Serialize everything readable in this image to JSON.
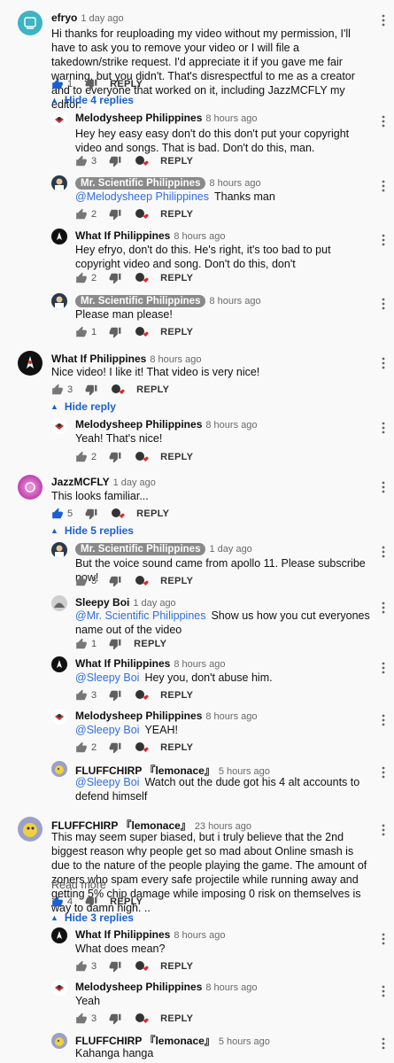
{
  "labels": {
    "reply": "REPLY",
    "read_more": "Read more"
  },
  "c1": {
    "author": "efryo",
    "time": "1 day ago",
    "text": "Hi thanks for reuploading my video without my permission, I'll have to ask you to remove your video or I will file a takedown/strike request. I'd appreciate it if you gave me fair warning, but you didn't. That's disrespectful to me as a creator and to everyone that worked on it, including JazzMCFLY my editor.",
    "likes": "1",
    "toggle": "Hide 4 replies",
    "r1": {
      "author": "Melodysheep Philippines",
      "time": "8 hours ago",
      "text": "Hey hey easy easy don't do this don't put your copyright video and songs. That is bad. Don't do this, man.",
      "likes": "3"
    },
    "r2": {
      "author": "Mr. Scientific Philippines",
      "time": "8 hours ago",
      "mention": "@Melodysheep Philippines",
      "text": "Thanks man",
      "likes": "2"
    },
    "r3": {
      "author": "What If Philippines",
      "time": "8 hours ago",
      "text": "Hey efryo, don't do this. He's right, it's too bad to put copyright video and song. Don't do this, don't",
      "likes": "2"
    },
    "r4": {
      "author": "Mr. Scientific Philippines",
      "time": "8 hours ago",
      "text": "Please man please!",
      "likes": "1"
    }
  },
  "c2": {
    "author": "What If Philippines",
    "time": "8 hours ago",
    "text": "Nice video! I like it! That video is very nice!",
    "likes": "3",
    "toggle": "Hide reply",
    "r1": {
      "author": "Melodysheep Philippines",
      "time": "8 hours ago",
      "text": "Yeah! That's nice!",
      "likes": "2"
    }
  },
  "c3": {
    "author": "JazzMCFLY",
    "time": "1 day ago",
    "text": "This looks familiar...",
    "likes": "5",
    "toggle": "Hide 5 replies",
    "r1": {
      "author": "Mr. Scientific Philippines",
      "time": "1 day ago",
      "text": "But the voice sound came from apollo 11. Please subscribe now!",
      "likes": "3"
    },
    "r2": {
      "author": "Sleepy Boi",
      "time": "1 day ago",
      "mention": "@Mr. Scientific Philippines",
      "text": "Show us how you cut everyones name out of the video",
      "likes": "1"
    },
    "r3": {
      "author": "What If Philippines",
      "time": "8 hours ago",
      "mention": "@Sleepy Boi",
      "text": "Hey you, don't abuse him.",
      "likes": "3"
    },
    "r4": {
      "author": "Melodysheep Philippines",
      "time": "8 hours ago",
      "mention": "@Sleepy Boi",
      "text": "YEAH!",
      "likes": "2"
    },
    "r5": {
      "author": "FLUFFCHIRP 『lemonace』",
      "time": "5 hours ago",
      "mention": "@Sleepy Boi",
      "text": "Watch out the dude got his 4 alt accounts to defend himself"
    }
  },
  "c4": {
    "author": "FLUFFCHIRP 『lemonace』",
    "time": "23 hours ago",
    "text": "This may seem super biased, but i truly believe that the 2nd biggest reason why people get so mad about Online smash is due to the nature of the people playing the game. The amount of zoners who spam every safe projectile while running away and getting 5% chip damage while imposing 0 risk on themselves is way to damn high. ..",
    "likes": "4",
    "toggle": "Hide 3 replies",
    "r1": {
      "author": "What If Philippines",
      "time": "8 hours ago",
      "text": "What does mean?",
      "likes": "3"
    },
    "r2": {
      "author": "Melodysheep Philippines",
      "time": "8 hours ago",
      "text": "Yeah",
      "likes": "3"
    },
    "r3": {
      "author": "FLUFFCHIRP 『lemonace』",
      "time": "5 hours ago",
      "text": "Kahanga hanga"
    }
  },
  "colors": {
    "link": "#1a5fd0",
    "mention": "#2f6ee0",
    "heart": "#e0262f",
    "badge": "#8a8a8a"
  }
}
